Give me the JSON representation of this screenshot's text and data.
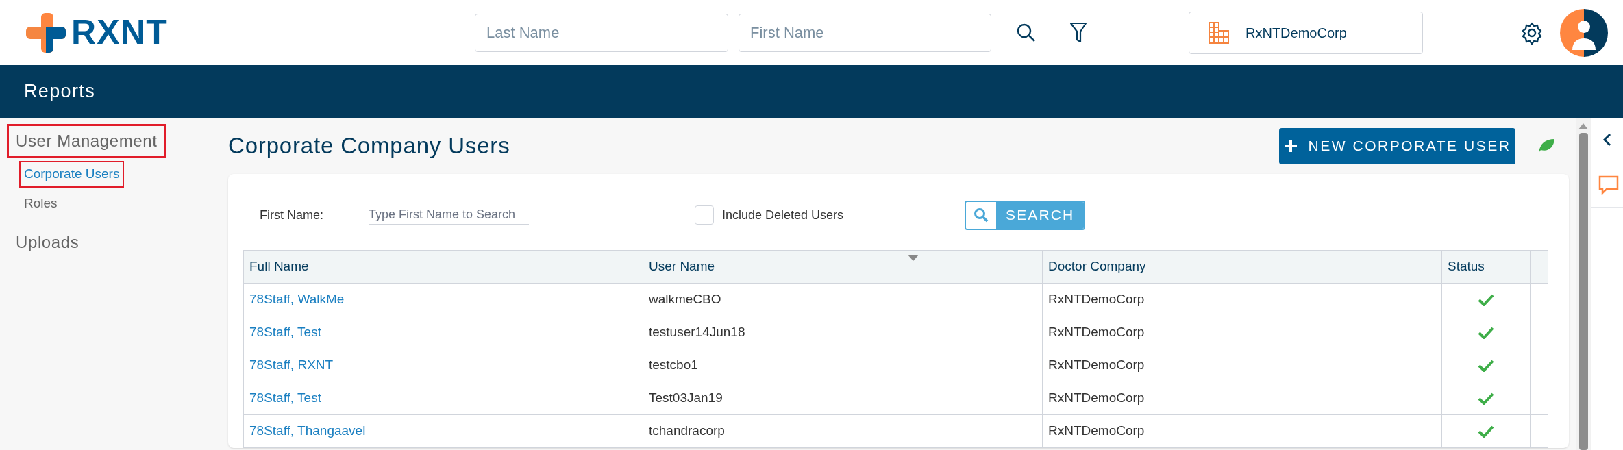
{
  "header": {
    "logo": "RXNT",
    "search_fields": [
      {
        "placeholder": "Last Name"
      },
      {
        "placeholder": "First Name"
      }
    ],
    "company": "RxNTDemoCorp"
  },
  "nav_bar": {
    "title": "Reports"
  },
  "sidebar": {
    "sections": [
      {
        "label": "User Management",
        "highlighted": true,
        "children": [
          {
            "label": "Corporate Users",
            "selected": true,
            "highlighted": true
          },
          {
            "label": "Roles",
            "selected": false,
            "highlighted": false
          }
        ]
      },
      {
        "label": "Uploads",
        "highlighted": false
      }
    ]
  },
  "page": {
    "title": "Corporate Company Users",
    "new_button": "NEW CORPORATE USER"
  },
  "filters": {
    "first_name_label": "First Name:",
    "first_name_placeholder": "Type First Name to Search",
    "include_deleted": {
      "label": "Include Deleted Users",
      "checked": false
    },
    "search_button": "SEARCH"
  },
  "table": {
    "columns": [
      "Full Name",
      "User Name",
      "Doctor Company",
      "Status"
    ],
    "rows": [
      {
        "full_name": "78Staff, WalkMe",
        "user_name": "walkmeCBO",
        "company": "RxNTDemoCorp",
        "active": true
      },
      {
        "full_name": "78Staff, Test",
        "user_name": "testuser14Jun18",
        "company": "RxNTDemoCorp",
        "active": true
      },
      {
        "full_name": "78Staff, RXNT",
        "user_name": "testcbo1",
        "company": "RxNTDemoCorp",
        "active": true
      },
      {
        "full_name": "78Staff, Test",
        "user_name": "Test03Jan19",
        "company": "RxNTDemoCorp",
        "active": true
      },
      {
        "full_name": "78Staff, Thangaavel",
        "user_name": "tchandracorp",
        "company": "RxNTDemoCorp",
        "active": true
      }
    ]
  }
}
